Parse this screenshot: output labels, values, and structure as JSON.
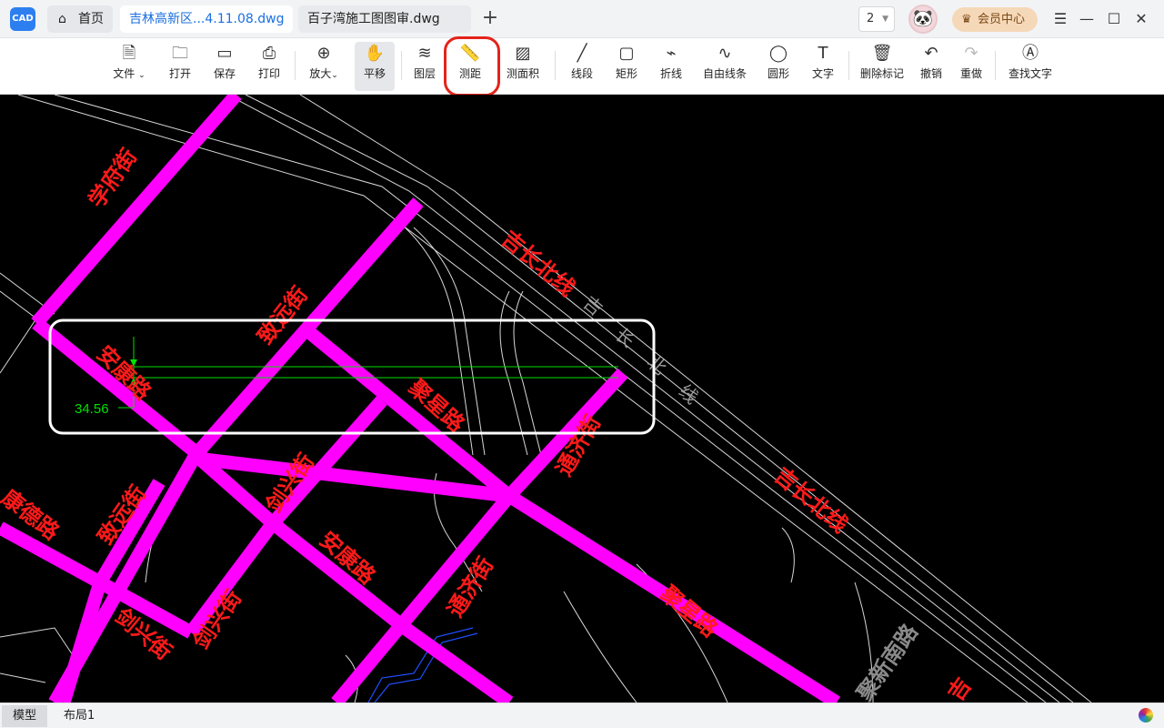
{
  "app": {
    "logo_text": "CAD"
  },
  "tabs": {
    "home": "首页",
    "active": "吉林高新区...4.11.08.dwg",
    "second": "百子湾施工图图审.dwg",
    "add": "+"
  },
  "header": {
    "page_number": "2",
    "vip_label": "会员中心",
    "menu_icon": "hamburger-icon",
    "minimize": "—",
    "maximize": "☐",
    "close": "✕"
  },
  "toolbar": {
    "items": [
      {
        "label": "文件",
        "icon": "file-icon",
        "dropdown": true
      },
      {
        "label": "打开",
        "icon": "folder-icon"
      },
      {
        "label": "保存",
        "icon": "save-icon"
      },
      {
        "label": "打印",
        "icon": "printer-icon"
      },
      {
        "label": "放大",
        "icon": "zoom-in-icon",
        "dropdown": true
      },
      {
        "label": "平移",
        "icon": "hand-icon",
        "pressed": true
      },
      {
        "label": "图层",
        "icon": "layers-icon"
      },
      {
        "label": "测距",
        "icon": "ruler-icon",
        "highlighted": true
      },
      {
        "label": "测面积",
        "icon": "area-icon"
      },
      {
        "label": "线段",
        "icon": "line-icon"
      },
      {
        "label": "矩形",
        "icon": "rectangle-icon"
      },
      {
        "label": "折线",
        "icon": "polyline-icon"
      },
      {
        "label": "自由线条",
        "icon": "freehand-icon"
      },
      {
        "label": "圆形",
        "icon": "circle-icon"
      },
      {
        "label": "文字",
        "icon": "text-icon"
      },
      {
        "label": "删除标记",
        "icon": "trash-icon"
      },
      {
        "label": "撤销",
        "icon": "undo-icon"
      },
      {
        "label": "重做",
        "icon": "redo-icon"
      },
      {
        "label": "查找文字",
        "icon": "find-text-icon"
      }
    ]
  },
  "drawing": {
    "street_labels": [
      "学府街",
      "致远街",
      "安康路",
      "聚星路",
      "通济街",
      "吉长北线",
      "吉长北线",
      "剑兴街",
      "致远街",
      "安康路",
      "通济街",
      "聚星路",
      "剑兴街",
      "剑兴街",
      "康德路",
      "聚新南路",
      "吉"
    ],
    "measurement_value": "34.56",
    "faint_text": [
      "吉",
      "长",
      "北",
      "线"
    ],
    "accent_color": "#ff00ff",
    "label_color": "#ff1a1a",
    "dimension_color": "#00e000"
  },
  "bottom": {
    "tabs": [
      "模型",
      "布局1"
    ]
  }
}
